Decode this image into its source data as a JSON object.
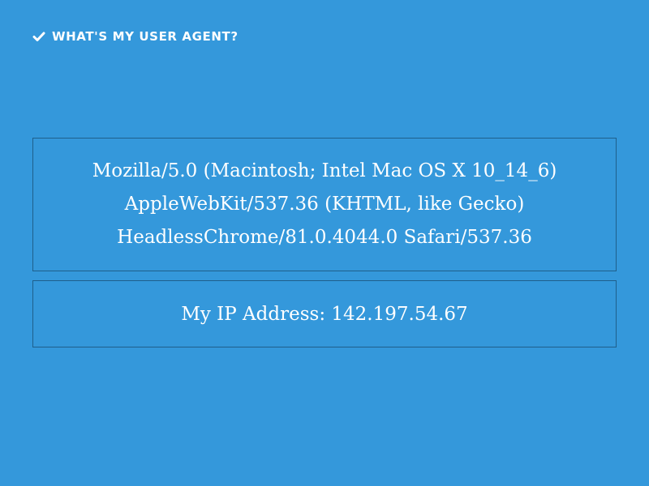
{
  "header": {
    "icon": "check-icon",
    "title": "What's my user agent?"
  },
  "user_agent": {
    "line1": "Mozilla/5.0 (Macintosh; Intel Mac OS X 10_14_6)",
    "line2": "AppleWebKit/537.36 (KHTML, like Gecko)",
    "line3": "HeadlessChrome/81.0.4044.0 Safari/537.36"
  },
  "ip": {
    "label": "My IP Address:",
    "value": "142.197.54.67"
  },
  "colors": {
    "background": "#3498db",
    "text": "#ffffff",
    "border": "#1f5f8b"
  }
}
